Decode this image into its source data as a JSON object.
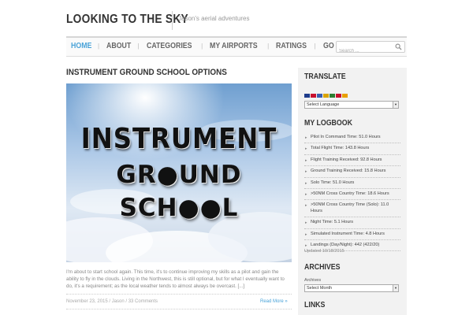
{
  "header": {
    "site_title": "Looking to the Sky",
    "tagline": "Jason's aerial adventures"
  },
  "nav": {
    "items": [
      {
        "label": "Home",
        "active": true
      },
      {
        "label": "About",
        "active": false
      },
      {
        "label": "Categories",
        "active": false
      },
      {
        "label": "My Airports",
        "active": false
      },
      {
        "label": "Ratings",
        "active": false
      },
      {
        "label": "Go Fly?",
        "active": false
      }
    ],
    "search_placeholder": "Search ...",
    "active_color": "#4aa3d8"
  },
  "post": {
    "title": "Instrument Ground School Options",
    "hero_lines": [
      "INSTRUMENT",
      "GR●UND",
      "SCH●●L"
    ],
    "excerpt": "I'm about to start school again.  This time, it's to continue improving my skills as a pilot and gain the ability to fly in the clouds.  Living in the Northwest, this is still optional, but for what I eventually want to do, it's a requirement; as the local weather tends to almost always be overcast.  [...]",
    "meta": "November 23, 2015 / Jason / 33 Comments",
    "read_more": "Read More »"
  },
  "sidebar": {
    "translate": {
      "title": "Translate",
      "select_value": "Select Language",
      "flag_colors": [
        "#1f3c8c",
        "#c8102e",
        "#3a5fb0",
        "#d9a400",
        "#2e7d32",
        "#c8102e",
        "#e8a000"
      ]
    },
    "logbook": {
      "title": "My Logbook",
      "items": [
        "Pilot In Command Time: 51.0 Hours",
        "Total Flight Time: 143.8 Hours",
        "Flight Training Received: 92.8 Hours",
        "Ground Training Received: 15.8 Hours",
        "Solo Time: 51.0 Hours",
        ">50NM Cross Country Time: 18.6 Hours",
        ">50NM Cross Country Time (Solo): 11.0 Hours",
        "Night Time: 5.1 Hours",
        "Simulated Instrument Time: 4.8 Hours",
        "Landings (Day/Night): 442 (422/20)"
      ],
      "updated": "Updated 10/18/2015"
    },
    "archives": {
      "title": "Archives",
      "label": "Archives",
      "select_value": "Select Month"
    },
    "links": {
      "title": "Links"
    }
  }
}
